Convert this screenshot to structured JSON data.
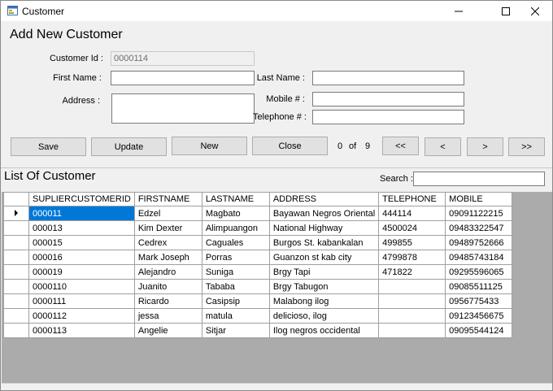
{
  "window": {
    "title": "Customer"
  },
  "form": {
    "heading": "Add New Customer",
    "customer_id_label": "Customer Id :",
    "customer_id_value": "0000114",
    "first_name_label": "First Name :",
    "first_name_value": "",
    "last_name_label": "Last Name :",
    "last_name_value": "",
    "address_label": "Address :",
    "address_value": "",
    "mobile_label": "Mobile # :",
    "mobile_value": "",
    "telephone_label": "Telephone # :",
    "telephone_value": ""
  },
  "buttons": {
    "save": "Save",
    "update": "Update",
    "new": "New",
    "close": "Close",
    "first": "<<",
    "prev": "<",
    "next": ">",
    "last": ">>"
  },
  "pager": {
    "current": "0",
    "of": "of",
    "total": "9"
  },
  "list": {
    "heading": "List Of Customer",
    "search_label": "Search :",
    "search_value": ""
  },
  "grid": {
    "columns": [
      "SUPLIERCUSTOMERID",
      "FIRSTNAME",
      "LASTNAME",
      "ADDRESS",
      "TELEPHONE",
      "MOBILE"
    ],
    "rows": [
      [
        "000011",
        "Edzel",
        "Magbato",
        "Bayawan Negros Oriental",
        "444114",
        "09091122215"
      ],
      [
        "000013",
        "Kim Dexter",
        "Alimpuangon",
        "National Highway",
        "4500024",
        "09483322547"
      ],
      [
        "000015",
        "Cedrex",
        "Caguales",
        "Burgos St. kabankalan",
        "499855",
        "09489752666"
      ],
      [
        "000016",
        "Mark Joseph",
        "Porras",
        "Guanzon st kab city",
        "4799878",
        "09485743184"
      ],
      [
        "000019",
        "Alejandro",
        "Suniga",
        "Brgy Tapi",
        "471822",
        "09295596065"
      ],
      [
        "0000110",
        "Juanito",
        "Tababa",
        "Brgy Tabugon",
        "",
        "09085511125"
      ],
      [
        "0000111",
        "Ricardo",
        "Casipsip",
        "Malabong ilog",
        "",
        "0956775433"
      ],
      [
        "0000112",
        "jessa",
        "matula",
        "delicioso, ilog",
        "",
        "09123456675"
      ],
      [
        "0000113",
        "Angelie",
        "Sitjar",
        "Ilog negros occidental",
        "",
        "09095544124"
      ]
    ],
    "selected_row": 0
  },
  "colors": {
    "selection": "#0078d7",
    "grid_background": "#ababab",
    "form_background": "#f0f0f0"
  }
}
